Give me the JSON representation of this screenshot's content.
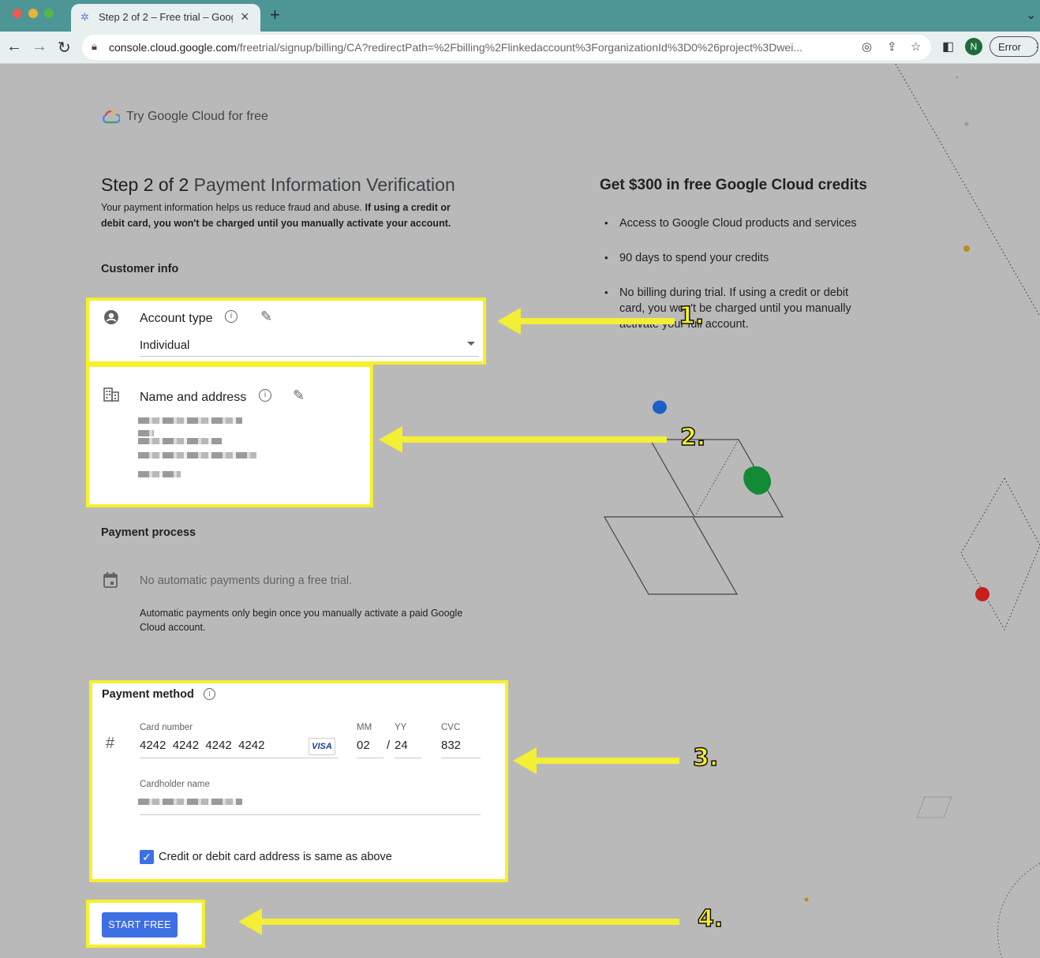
{
  "browser": {
    "tab_title": "Step 2 of 2 – Free trial – Googl",
    "url_host": "console.cloud.google.com",
    "url_path": "/freetrial/signup/billing/CA?redirectPath=%2Fbilling%2Flinkedaccount%3ForganizationId%3D0%26project%3Dwei...",
    "profile_initial": "N",
    "error_label": "Error"
  },
  "header": {
    "brand": "Try Google Cloud for free"
  },
  "step": {
    "prefix": "Step 2 of 2",
    "title": "Payment Information Verification",
    "intro_plain": "Your payment information helps us reduce fraud and abuse. ",
    "intro_bold": "If using a credit or debit card, you won't be charged until you manually activate your account."
  },
  "customer_info": {
    "heading": "Customer info",
    "account_type_label": "Account type",
    "account_type_value": "Individual",
    "name_address_label": "Name and address"
  },
  "payment_process": {
    "heading": "Payment process",
    "line1": "No automatic payments during a free trial.",
    "line2": "Automatic payments only begin once you manually activate a paid Google Cloud account."
  },
  "payment_method": {
    "heading": "Payment method",
    "card_number_label": "Card number",
    "card_number": "4242  4242  4242  4242",
    "card_brand": "VISA",
    "mm_label": "MM",
    "mm": "02",
    "yy_label": "YY",
    "yy": "24",
    "cvc_label": "CVC",
    "cvc": "832",
    "cardholder_label": "Cardholder name",
    "same_address_label": "Credit or debit card address is same as above",
    "same_address_checked": true
  },
  "cta": {
    "start_free": "START FREE"
  },
  "promo": {
    "title": "Get $300 in free Google Cloud credits",
    "bullets": [
      "Access to Google Cloud products and services",
      "90 days to spend your credits",
      "No billing during trial. If using a credit or debit card, you won't be charged until you manually activate your full account."
    ]
  },
  "annotations": {
    "n1": "1.",
    "n2": "2.",
    "n3": "3.",
    "n4": "4."
  },
  "colors": {
    "highlight": "#f6f02a",
    "button": "#3f6fe4",
    "overlay": "#b9b9b9"
  },
  "icons": [
    "search-icon",
    "info-icon",
    "edit-icon",
    "account-circle-icon",
    "business-icon",
    "calendar-icon",
    "hash-icon",
    "check-icon",
    "lock-icon",
    "star-icon"
  ]
}
